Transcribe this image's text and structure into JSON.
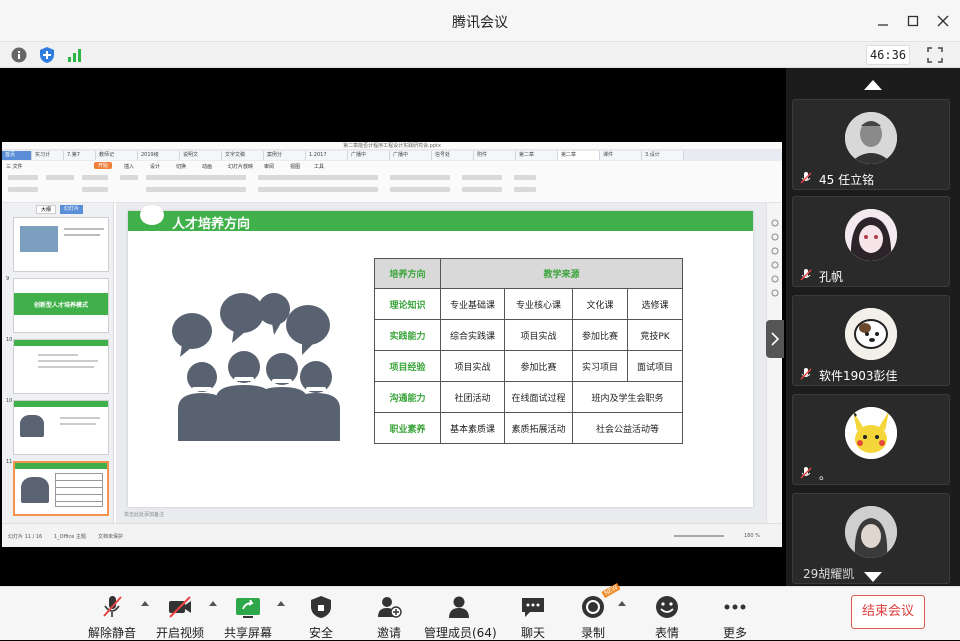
{
  "window": {
    "title": "腾讯会议"
  },
  "infobar": {
    "timer": "46:36"
  },
  "toolbar": {
    "unmute": "解除静音",
    "video": "开启视频",
    "share": "共享屏幕",
    "security": "安全",
    "invite": "邀请",
    "members": "管理成员(64)",
    "chat": "聊天",
    "record": "录制",
    "record_badge": "NEW",
    "reactions": "表情",
    "more": "更多",
    "end": "结束会议"
  },
  "participants": [
    {
      "name": "45  任立铭"
    },
    {
      "name": "孔帆"
    },
    {
      "name": "软件1903彭佳"
    },
    {
      "name": "。"
    },
    {
      "name": "29胡耀凯"
    }
  ],
  "shared_screen": {
    "doc_title": "第二章能否计程序工程设计实践研究会.pptx",
    "tabs": [
      "首页",
      "实习计",
      "7.第7",
      "教师记",
      "2019级",
      "说明文",
      "文字文稿",
      "案例分",
      "1.2017",
      "广播中",
      "广播中",
      "信号处",
      "附件",
      "第二章",
      "第二章",
      "课件",
      "3.设计"
    ],
    "menu": [
      "三 文件",
      "开始",
      "插入",
      "设计",
      "切换",
      "动画",
      "幻灯片放映",
      "审阅",
      "视图",
      "工具"
    ],
    "leftpane_tabs": [
      "大纲",
      "幻灯片"
    ],
    "thumbs": [
      {
        "num": "",
        "text": ""
      },
      {
        "num": "9",
        "text": "创新型人才培养模式"
      },
      {
        "num": "10",
        "text": ""
      },
      {
        "num": "10",
        "text": ""
      },
      {
        "num": "11",
        "text": ""
      }
    ],
    "slide": {
      "banner_title": "人才培养方向",
      "table_header": [
        "培养方向",
        "教学来源"
      ],
      "rows": [
        {
          "head": "理论知识",
          "cells": [
            "专业基础课",
            "专业核心课",
            "文化课",
            "选修课"
          ]
        },
        {
          "head": "实践能力",
          "cells": [
            "综合实践课",
            "项目实战",
            "参加比赛",
            "竞技PK"
          ]
        },
        {
          "head": "项目经验",
          "cells": [
            "项目实战",
            "参加比赛",
            "实习项目",
            "面试项目"
          ]
        },
        {
          "head": "沟通能力",
          "cells": [
            "社团活动",
            "在线面试过程",
            "班内及学生会职务"
          ]
        },
        {
          "head": "职业素养",
          "cells": [
            "基本素质课",
            "素质拓展活动",
            "社会公益活动等"
          ]
        }
      ]
    },
    "status": {
      "slide_no": "幻灯片 11 / 16",
      "theme": "1_Office 主题",
      "protect": "文档未保护",
      "notes": "单击此处添加备注",
      "zoom": "180 %"
    }
  }
}
